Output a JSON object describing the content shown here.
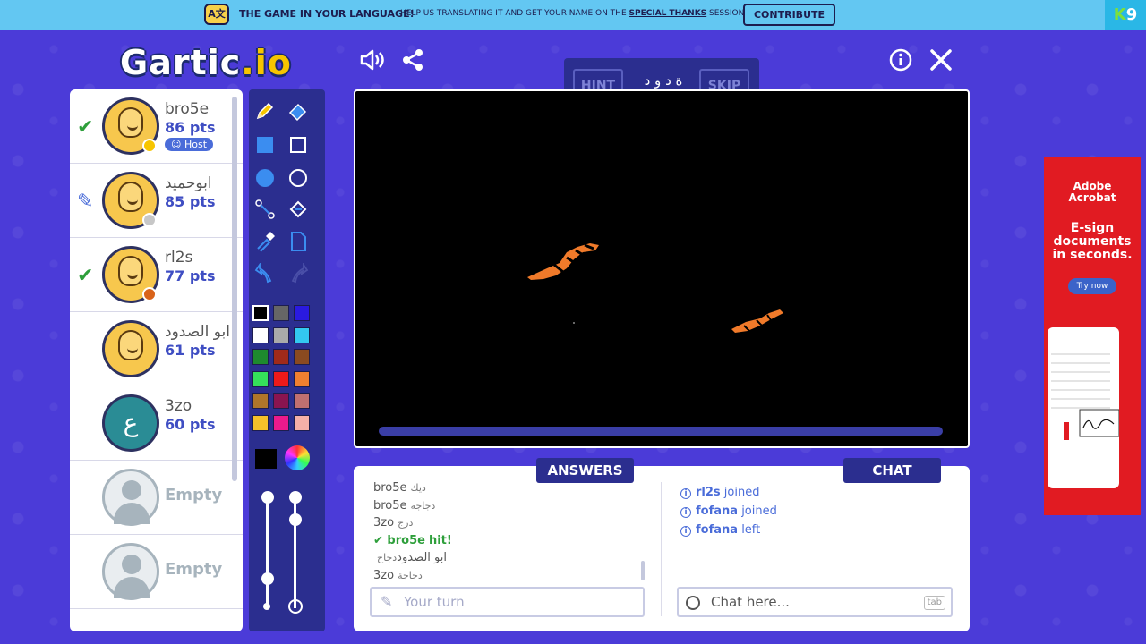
{
  "banner": {
    "lang_icon": "translate-icon",
    "title": "THE GAME IN YOUR LANGUAGE!",
    "help_prefix": "HELP US TRANSLATING IT AND GET YOUR NAME ON THE",
    "help_link": "SPECIAL THANKS",
    "help_suffix": "SESSION",
    "contribute_label": "CONTRIBUTE",
    "k9_k": "K",
    "k9_num": "9"
  },
  "logo": {
    "main": "Gartic",
    "suffix": ".io"
  },
  "players": [
    {
      "name": "bro5e",
      "pts": "86 pts",
      "host": "Host",
      "status": "✔",
      "status_color": "#2e9f3b",
      "dot": "#f7c500",
      "avatar": "face"
    },
    {
      "name": "ابوحميد",
      "pts": "85 pts",
      "status": "✎",
      "status_color": "#4a6cd9",
      "dot": "#c7c7c7",
      "avatar": "face"
    },
    {
      "name": "rl2s",
      "pts": "77 pts",
      "status": "✔",
      "status_color": "#2e9f3b",
      "dot": "#d9631a",
      "avatar": "face"
    },
    {
      "name": "ابو الصدود",
      "pts": "61 pts",
      "avatar": "face"
    },
    {
      "name": "3zo",
      "pts": "60 pts",
      "avatar": "teal",
      "avatar_letter": "ع"
    },
    {
      "name": "Empty",
      "avatar": "empty"
    },
    {
      "name": "Empty",
      "avatar": "empty"
    }
  ],
  "word": {
    "hint_label": "HINT",
    "skip_label": "SKIP",
    "letters": "ة د و د"
  },
  "palette": [
    "#000000",
    "#666666",
    "#2a1ae0",
    "#ffffff",
    "#aaaaaa",
    "#33c8f0",
    "#1e8a2e",
    "#a02a1a",
    "#8a4a20",
    "#35e05a",
    "#ec1a1a",
    "#f08030",
    "#b0762a",
    "#8a1450",
    "#c07070",
    "#f5c02a",
    "#ec1a8c",
    "#f5b0a8"
  ],
  "tools": {
    "selected_color": "#000000"
  },
  "answers": {
    "tab_label": "ANSWERS",
    "lines": [
      {
        "user": "bro5e",
        "word": "ديك"
      },
      {
        "user": "bro5e",
        "word": "دجاجه"
      },
      {
        "user": "3zo",
        "word": "درج"
      },
      {
        "user": "bro5e",
        "word": "hit!",
        "hit": true
      },
      {
        "user": "ابو الصدود",
        "word": "دجاج"
      },
      {
        "user": "3zo",
        "word": "دجاجة"
      }
    ],
    "input_placeholder": "Your turn"
  },
  "chat": {
    "tab_label": "CHAT",
    "lines": [
      {
        "user": "rl2s",
        "action": "joined"
      },
      {
        "user": "fofana",
        "action": "joined"
      },
      {
        "user": "fofana",
        "action": "left"
      }
    ],
    "input_placeholder": "Chat here...",
    "tab_key": "tab"
  },
  "ad": {
    "brand_line1": "Adobe",
    "brand_line2": "Acrobat",
    "headline_1": "E-sign",
    "headline_2": "documents",
    "headline_3": "in seconds.",
    "cta": "Try now"
  }
}
